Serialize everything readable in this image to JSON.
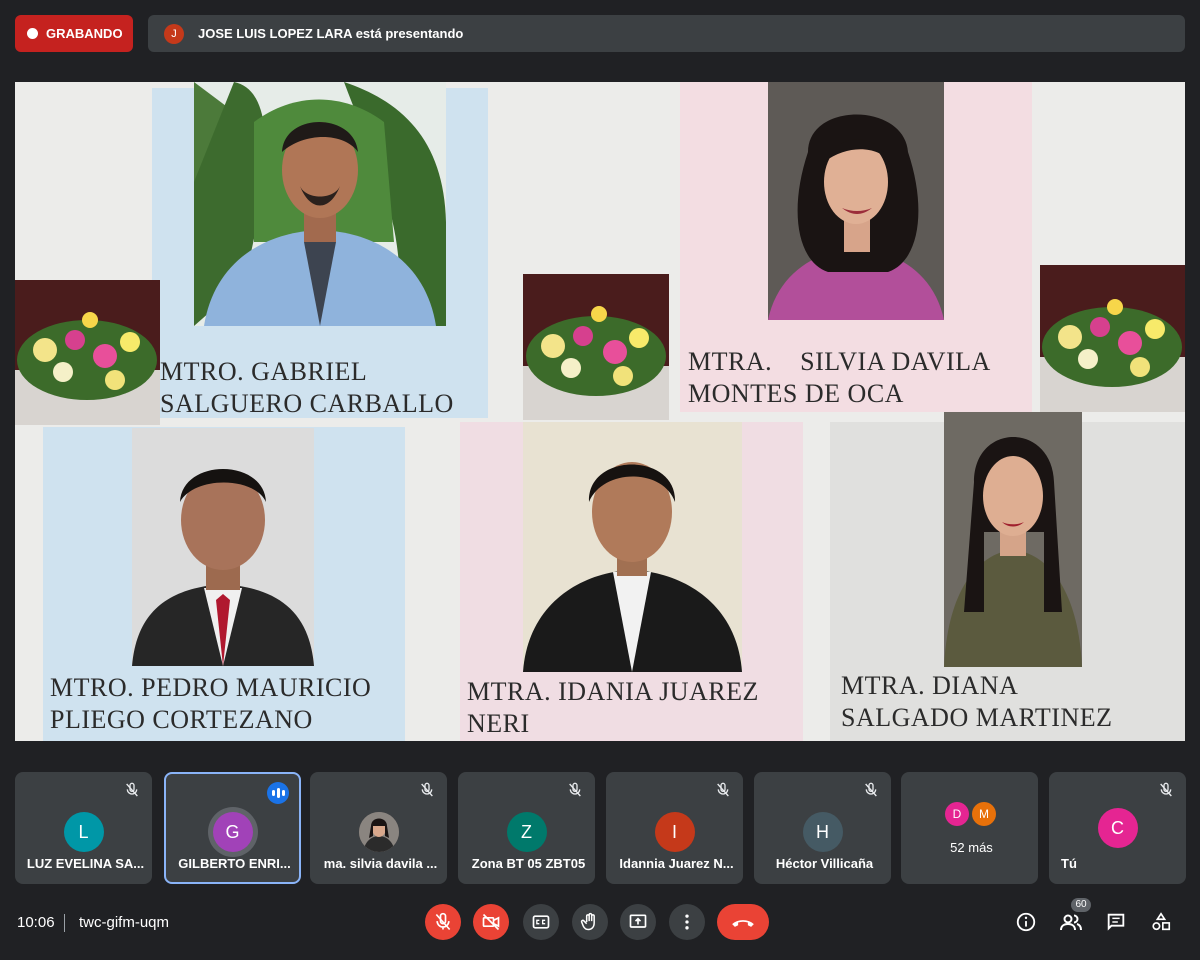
{
  "recording": {
    "label": "GRABANDO"
  },
  "presenter": {
    "initial": "J",
    "text": "JOSE LUIS LOPEZ LARA está presentando"
  },
  "slide": {
    "names": [
      "MTRO. GABRIEL\nSALGUERO CARBALLO",
      "MTRA.    SILVIA DAVILA\nMONTES DE OCA",
      "MTRO. PEDRO MAURICIO\nPLIEGO CORTEZANO",
      "MTRA. IDANIA JUAREZ\nNERI",
      "MTRA. DIANA\nSALGADO MARTINEZ"
    ]
  },
  "participants": [
    {
      "initial": "L",
      "name": "LUZ EVELINA SA...",
      "color": "#0097a7",
      "muted": true
    },
    {
      "initial": "G",
      "name": "GILBERTO ENRI...",
      "color": "#a142b8",
      "speaking": true
    },
    {
      "initial": "",
      "name": "ma. silvia davila ...",
      "muted": true,
      "photo": true
    },
    {
      "initial": "Z",
      "name": "Zona BT 05 ZBT05",
      "color": "#00796b",
      "muted": true
    },
    {
      "initial": "I",
      "name": "Idannia Juarez N...",
      "color": "#c5391a",
      "muted": true
    },
    {
      "initial": "H",
      "name": "Héctor Villicaña",
      "color": "#455a64",
      "muted": true
    },
    {
      "initial": "",
      "name": "52 más",
      "more_avatars": [
        {
          "initial": "D",
          "color": "#e52592"
        },
        {
          "initial": "M",
          "color": "#e8710a"
        }
      ]
    },
    {
      "initial": "C",
      "name": "Tú",
      "color": "#e52592",
      "muted": true
    }
  ],
  "bottom_bar": {
    "time": "10:06",
    "meeting_code": "twc-gifm-uqm",
    "people_count": "60"
  },
  "colors": {
    "recording": "#c5221f",
    "danger": "#ea4335",
    "accent": "#8ab4f8",
    "tile_bg": "#3c4043",
    "page_bg": "#202124"
  }
}
